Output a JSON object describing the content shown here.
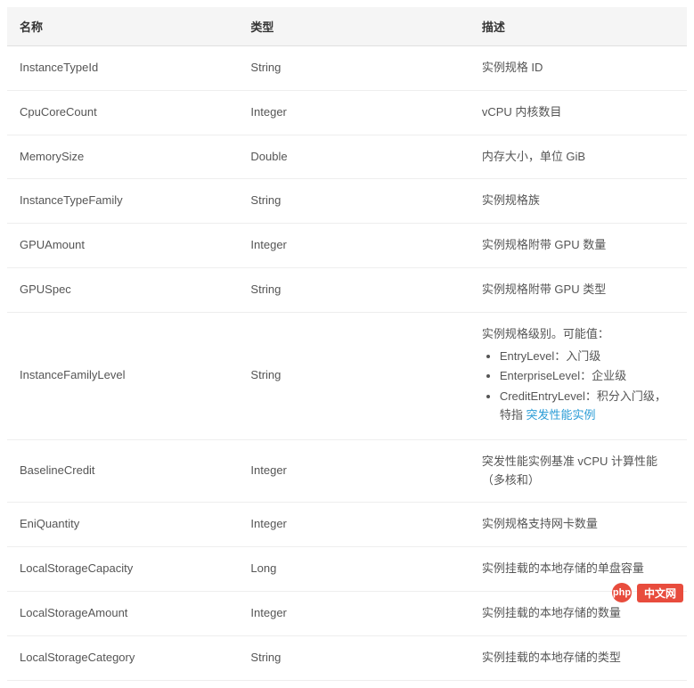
{
  "headers": {
    "name": "名称",
    "type": "类型",
    "desc": "描述"
  },
  "rows": [
    {
      "name": "InstanceTypeId",
      "type": "String",
      "desc": "实例规格 ID"
    },
    {
      "name": "CpuCoreCount",
      "type": "Integer",
      "desc": "vCPU 内核数目"
    },
    {
      "name": "MemorySize",
      "type": "Double",
      "desc": "内存大小，单位 GiB"
    },
    {
      "name": "InstanceTypeFamily",
      "type": "String",
      "desc": "实例规格族"
    },
    {
      "name": "GPUAmount",
      "type": "Integer",
      "desc": "实例规格附带 GPU 数量"
    },
    {
      "name": "GPUSpec",
      "type": "String",
      "desc": "实例规格附带 GPU 类型"
    },
    {
      "name": "InstanceFamilyLevel",
      "type": "String",
      "desc_kind": "complex"
    },
    {
      "name": "BaselineCredit",
      "type": "Integer",
      "desc": "突发性能实例基准 vCPU 计算性能（多核和）"
    },
    {
      "name": "EniQuantity",
      "type": "Integer",
      "desc": "实例规格支持网卡数量"
    },
    {
      "name": "LocalStorageCapacity",
      "type": "Long",
      "desc": "实例挂载的本地存储的单盘容量"
    },
    {
      "name": "LocalStorageAmount",
      "type": "Integer",
      "desc": "实例挂载的本地存储的数量"
    },
    {
      "name": "LocalStorageCategory",
      "type": "String",
      "desc": "实例挂载的本地存储的类型"
    }
  ],
  "complex": {
    "intro": "实例规格级别。可能值：",
    "items": [
      "EntryLevel：入门级",
      "EnterpriseLevel：企业级"
    ],
    "last_prefix": "CreditEntryLevel：积分入门级，特指 ",
    "last_link": "突发性能实例"
  },
  "watermark": {
    "logo": "php",
    "label": "中文网"
  }
}
